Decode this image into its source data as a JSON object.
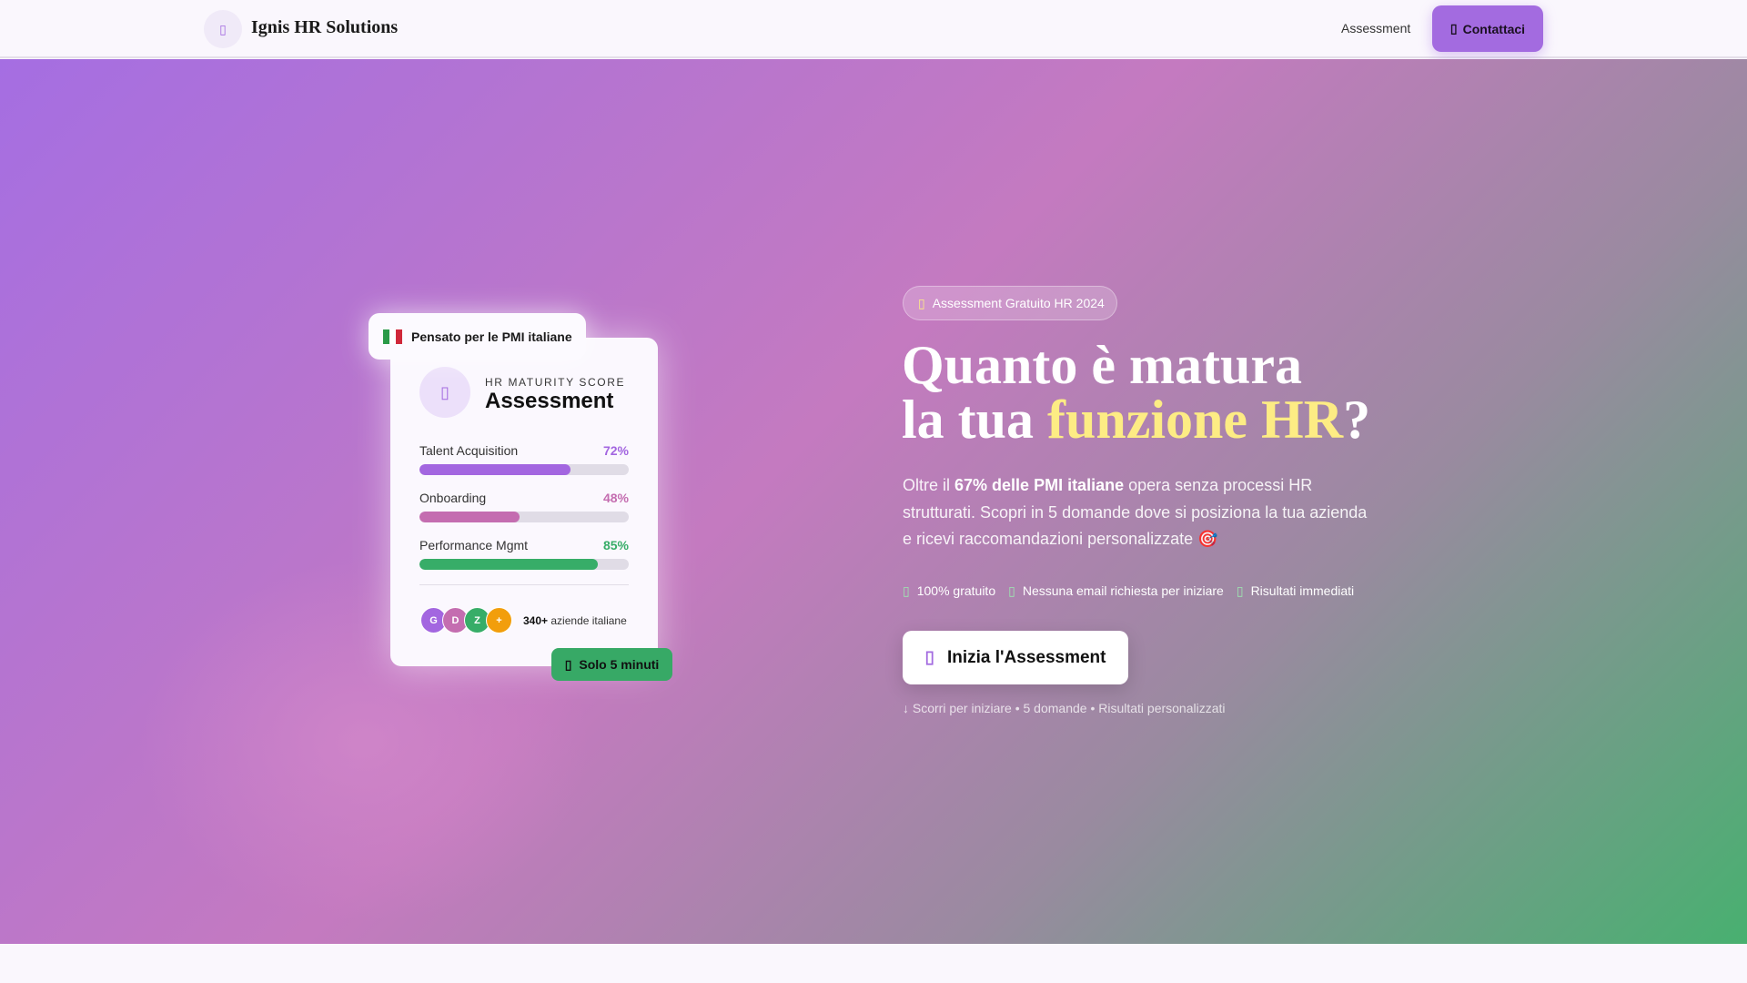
{
  "nav": {
    "brand": "Ignis HR Solutions",
    "link": "Assessment",
    "cta": "Contattaci"
  },
  "card": {
    "tag": "Pensato per le PMI italiane",
    "subtitle": "HR MATURITY SCORE",
    "title": "Assessment",
    "metrics": [
      {
        "label": "Talent Acquisition",
        "value": "72%",
        "pct": 72,
        "color": "#a366e0"
      },
      {
        "label": "Onboarding",
        "value": "48%",
        "pct": 48,
        "color": "#c46db0"
      },
      {
        "label": "Performance Mgmt",
        "value": "85%",
        "pct": 85,
        "color": "#37ad68"
      }
    ],
    "avatars": [
      "G",
      "D",
      "Z",
      "+"
    ],
    "count": "340+",
    "count_label": "aziende italiane",
    "pill": "Solo 5 minuti"
  },
  "hero": {
    "badge": "Assessment Gratuito HR 2024",
    "title_1": "Quanto è matura",
    "title_2a": "la tua ",
    "title_2b": "funzione HR",
    "title_2c": "?",
    "para_a": "Oltre il ",
    "para_b": "67% delle PMI italiane",
    "para_c": " opera senza processi HR strutturati. Scopri in 5 domande dove si posiziona la tua azienda e ricevi raccomandazioni personalizzate 🎯",
    "checks": [
      "100% gratuito",
      "Nessuna email richiesta per iniziare",
      "Risultati immediati"
    ],
    "button": "Inizia l'Assessment",
    "note": "↓ Scorri per iniziare • 5 domande • Risultati personalizzati"
  }
}
